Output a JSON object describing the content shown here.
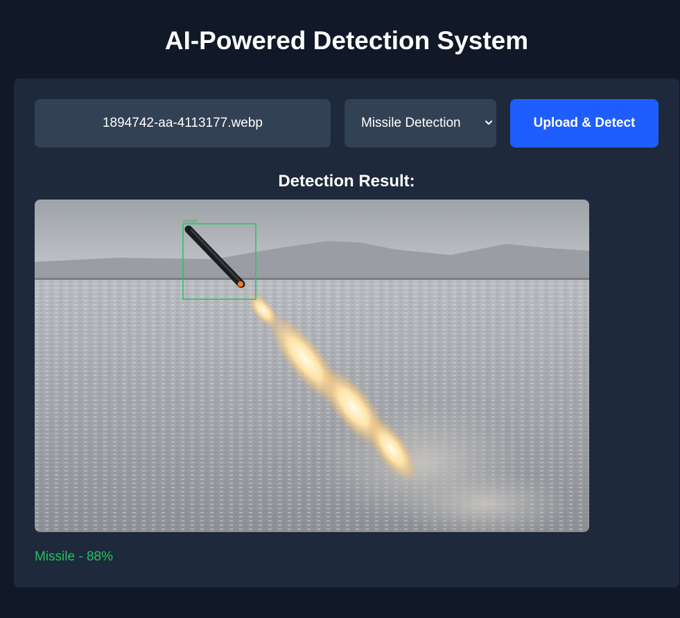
{
  "header": {
    "title": "AI-Powered Detection System"
  },
  "upload": {
    "file_name": "1894742-aa-4113177.webp",
    "model_select": "Missile Detection",
    "button_label": "Upload & Detect"
  },
  "result": {
    "heading": "Detection Result:",
    "box_label": "missile",
    "summary": "Missile - 88%"
  },
  "colors": {
    "background": "#111827",
    "panel": "#1e293b",
    "control": "#334155",
    "accent": "#1e5eff",
    "success": "#22c55e",
    "detection_box": "#22c55e"
  },
  "icons": {
    "select_chevron": "chevron-down-icon"
  }
}
